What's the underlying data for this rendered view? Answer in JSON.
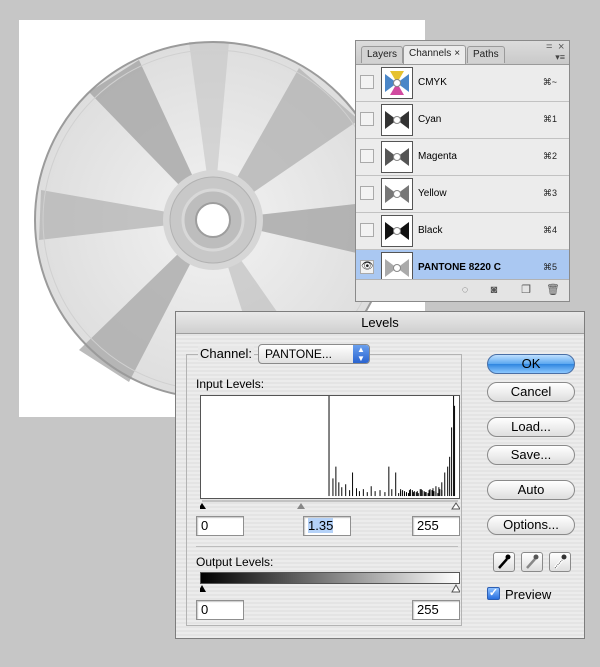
{
  "channels_panel": {
    "tabs": [
      {
        "label": "Layers",
        "active": false
      },
      {
        "label": "Channels",
        "active": true
      },
      {
        "label": "Paths",
        "active": false
      }
    ],
    "tab_close_glyph": "×",
    "minimize_glyph": "=",
    "close_glyph": "×",
    "menu_glyph": "▾≡",
    "rows": [
      {
        "name": "CMYK",
        "shortcut": "⌘~",
        "visible": false,
        "selected": false,
        "thumb": "composite"
      },
      {
        "name": "Cyan",
        "shortcut": "⌘1",
        "visible": false,
        "selected": false,
        "thumb": "cyan"
      },
      {
        "name": "Magenta",
        "shortcut": "⌘2",
        "visible": false,
        "selected": false,
        "thumb": "magenta"
      },
      {
        "name": "Yellow",
        "shortcut": "⌘3",
        "visible": false,
        "selected": false,
        "thumb": "yellow"
      },
      {
        "name": "Black",
        "shortcut": "⌘4",
        "visible": false,
        "selected": false,
        "thumb": "black"
      },
      {
        "name": "PANTONE 8220 C",
        "shortcut": "⌘5",
        "visible": true,
        "selected": true,
        "thumb": "pantone"
      }
    ],
    "eye_glyph": "👁",
    "bottom_icons": [
      "dotted-circle-icon",
      "mask-icon",
      "new-channel-icon",
      "trash-icon"
    ],
    "selected_color": "#aac8f2"
  },
  "levels": {
    "title": "Levels",
    "channel_label": "Channel:",
    "channel_value": "PANTONE...",
    "channel_arrows": "▲\n▼",
    "input_label": "Input Levels:",
    "input_black": "0",
    "input_gamma": "1.35",
    "input_white": "255",
    "output_label": "Output Levels:",
    "output_black": "0",
    "output_white": "255",
    "buttons": {
      "ok": "OK",
      "cancel": "Cancel",
      "load": "Load...",
      "save": "Save...",
      "auto": "Auto",
      "options": "Options..."
    },
    "preview_label": "Preview",
    "preview_checked": true,
    "check_glyph": "✓",
    "accent_color": "#3b8ae6"
  }
}
